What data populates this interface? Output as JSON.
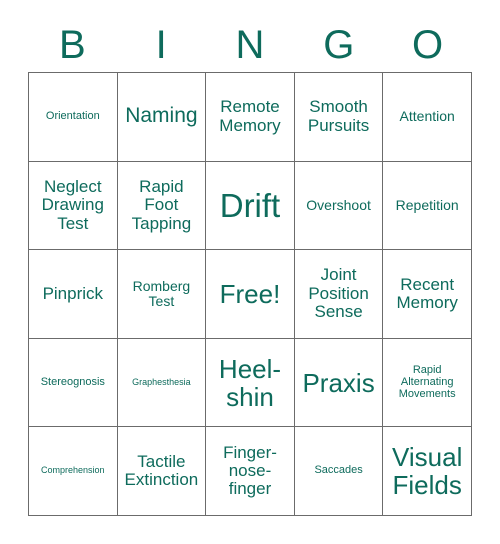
{
  "card": {
    "header_letters": [
      "B",
      "I",
      "N",
      "G",
      "O"
    ],
    "accent_color": "#0e6b5c",
    "border_color": "#6b6b6b",
    "background_color": "#ffffff",
    "columns": 5,
    "rows": 5,
    "cells": [
      {
        "text": "Orientation",
        "size": "s"
      },
      {
        "text": "Naming",
        "size": "xl"
      },
      {
        "text": "Remote Memory",
        "size": "l"
      },
      {
        "text": "Smooth Pursuits",
        "size": "l"
      },
      {
        "text": "Attention",
        "size": "m"
      },
      {
        "text": "Neglect Drawing Test",
        "size": "l"
      },
      {
        "text": "Rapid Foot Tapping",
        "size": "l"
      },
      {
        "text": "Drift",
        "size": "huge"
      },
      {
        "text": "Overshoot",
        "size": "m"
      },
      {
        "text": "Repetition",
        "size": "m"
      },
      {
        "text": "Pinprick",
        "size": "l"
      },
      {
        "text": "Romberg Test",
        "size": "m"
      },
      {
        "text": "Free!",
        "size": "xxl"
      },
      {
        "text": "Joint Position Sense",
        "size": "l"
      },
      {
        "text": "Recent Memory",
        "size": "l"
      },
      {
        "text": "Stereognosis",
        "size": "s"
      },
      {
        "text": "Graphesthesia",
        "size": "xs"
      },
      {
        "text": "Heel-shin",
        "size": "xxl"
      },
      {
        "text": "Praxis",
        "size": "xxl"
      },
      {
        "text": "Rapid Alternating Movements",
        "size": "s"
      },
      {
        "text": "Comprehension",
        "size": "xs"
      },
      {
        "text": "Tactile Extinction",
        "size": "l"
      },
      {
        "text": "Finger-nose-finger",
        "size": "l"
      },
      {
        "text": "Saccades",
        "size": "s"
      },
      {
        "text": "Visual Fields",
        "size": "xxl"
      }
    ]
  }
}
